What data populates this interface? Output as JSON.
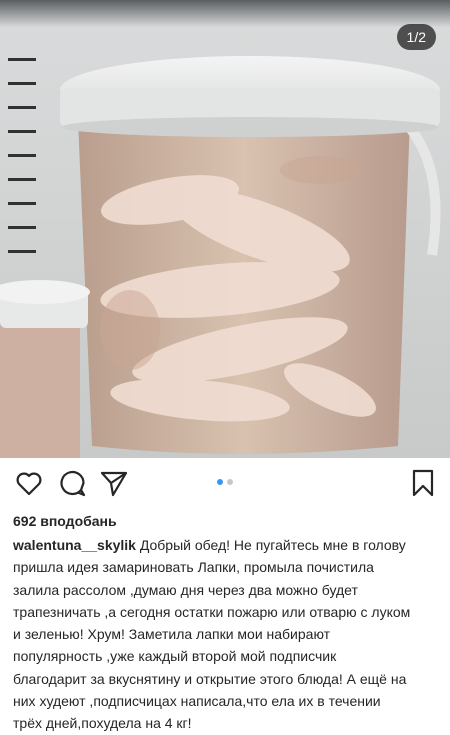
{
  "post": {
    "image_counter": "1/2",
    "image_description": "photo",
    "likes": "692 вподобань",
    "username": "walentuna__skylik",
    "caption": "Добрый обед! Не пугайтесь мне в голову пришла идея замариновать  Лапки, промыла почистила залила рассолом ,думаю дня через два можно будет трапезничать ,а сегодня остатки пожарю или отварю с луком и зеленью! Хрум! Заметила  лапки мои набирают популярность ,уже каждый второй мой подписчик благодарит за вкуснятину  и открытие этого блюда! А ещё на них худеют ,подписчицах написала,что ела их в течении трёх дней,похудела на 4 кг!"
  },
  "icons": {
    "like": "heart-icon",
    "comment": "comment-icon",
    "share": "send-icon",
    "save": "bookmark-icon"
  },
  "carousel": {
    "active_index": 1,
    "total": 2,
    "active_color": "#3897f0",
    "inactive_color": "#c7c7c7"
  }
}
